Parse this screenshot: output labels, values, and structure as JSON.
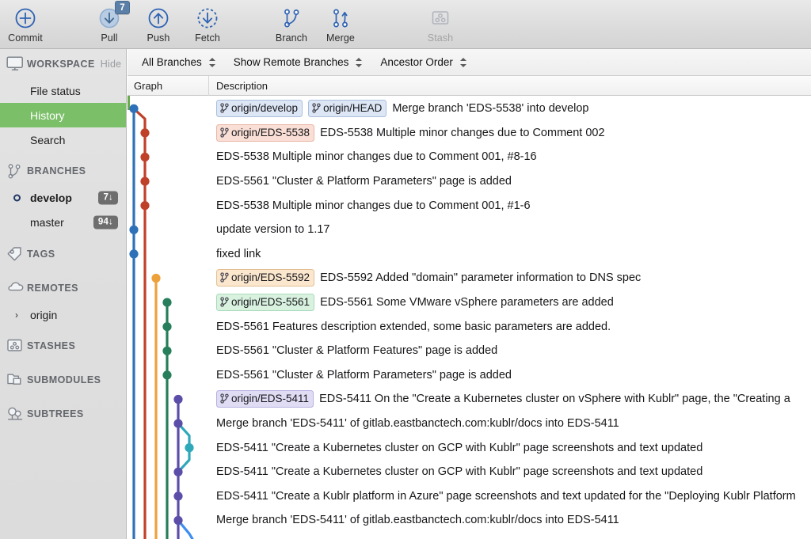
{
  "toolbar": {
    "items": [
      {
        "label": "Commit",
        "icon": "commit-plus-icon",
        "badge": null,
        "disabled": false
      },
      {
        "label": "Pull",
        "icon": "pull-down-arrow-icon",
        "badge": "7",
        "disabled": false
      },
      {
        "label": "Push",
        "icon": "push-up-arrow-icon",
        "badge": null,
        "disabled": false
      },
      {
        "label": "Fetch",
        "icon": "fetch-dashed-down-arrow-icon",
        "badge": null,
        "disabled": false
      },
      {
        "label": "Branch",
        "icon": "branch-icon",
        "badge": null,
        "disabled": false
      },
      {
        "label": "Merge",
        "icon": "merge-icon",
        "badge": null,
        "disabled": false
      },
      {
        "label": "Stash",
        "icon": "stash-icon",
        "badge": null,
        "disabled": true
      }
    ]
  },
  "sidebar": {
    "workspace": {
      "title": "WORKSPACE",
      "hide_label": "Hide",
      "icon": "monitor-icon"
    },
    "workspace_items": [
      {
        "label": "File status",
        "selected": false
      },
      {
        "label": "History",
        "selected": true
      },
      {
        "label": "Search",
        "selected": false
      }
    ],
    "branches": {
      "title": "BRANCHES",
      "icon": "branch-icon"
    },
    "branch_items": [
      {
        "label": "develop",
        "count": "7↓",
        "current": true
      },
      {
        "label": "master",
        "count": "94↓",
        "current": false
      }
    ],
    "tags": {
      "title": "TAGS",
      "icon": "tag-icon"
    },
    "remotes": {
      "title": "REMOTES",
      "icon": "cloud-icon"
    },
    "remote_items": [
      {
        "label": "origin",
        "expanded": false
      }
    ],
    "stashes": {
      "title": "STASHES",
      "icon": "stash-icon"
    },
    "submodules": {
      "title": "SUBMODULES",
      "icon": "submodules-icon"
    },
    "subtrees": {
      "title": "SUBTREES",
      "icon": "subtrees-icon"
    }
  },
  "filter_bar": {
    "branch_filter": "All Branches",
    "remote_filter": "Show Remote Branches",
    "order_filter": "Ancestor Order"
  },
  "columns": {
    "graph": "Graph",
    "description": "Description"
  },
  "commits": [
    {
      "refs": [
        {
          "name": "origin/develop",
          "style": "tag-blue"
        },
        {
          "name": "origin/HEAD",
          "style": "tag-blue"
        }
      ],
      "message": "Merge branch 'EDS-5538' into develop"
    },
    {
      "refs": [
        {
          "name": "origin/EDS-5538",
          "style": "tag-red"
        }
      ],
      "message": "EDS-5538 Multiple minor changes due to Comment 002"
    },
    {
      "refs": [],
      "message": "EDS-5538 Multiple minor changes due to Comment 001, #8-16"
    },
    {
      "refs": [],
      "message": "EDS-5561 \"Cluster & Platform Parameters\" page is added"
    },
    {
      "refs": [],
      "message": "EDS-5538 Multiple minor changes due to Comment 001, #1-6"
    },
    {
      "refs": [],
      "message": "update version to 1.17"
    },
    {
      "refs": [],
      "message": "fixed link"
    },
    {
      "refs": [
        {
          "name": "origin/EDS-5592",
          "style": "tag-orange"
        }
      ],
      "message": "EDS-5592 Added \"domain\" parameter information to DNS spec"
    },
    {
      "refs": [
        {
          "name": "origin/EDS-5561",
          "style": "tag-green"
        }
      ],
      "message": "EDS-5561 Some VMware vSphere parameters are added"
    },
    {
      "refs": [],
      "message": "EDS-5561 Features description extended, some basic parameters are added."
    },
    {
      "refs": [],
      "message": "EDS-5561 \"Cluster & Platform Features\" page is added"
    },
    {
      "refs": [],
      "message": "EDS-5561 \"Cluster & Platform Parameters\" page is added"
    },
    {
      "refs": [
        {
          "name": "origin/EDS-5411",
          "style": "tag-purple"
        }
      ],
      "message": "EDS-5411 On the \"Create a Kubernetes cluster on vSphere with Kublr\" page, the \"Creating a"
    },
    {
      "refs": [],
      "message": "Merge branch 'EDS-5411' of gitlab.eastbanctech.com:kublr/docs into EDS-5411"
    },
    {
      "refs": [],
      "message": "EDS-5411 \"Create a Kubernetes cluster on GCP with Kublr\" page screenshots and text updated"
    },
    {
      "refs": [],
      "message": "EDS-5411 \"Create a Kubernetes cluster on GCP with Kublr\" page screenshots and text updated"
    },
    {
      "refs": [],
      "message": "EDS-5411 \"Create a Kublr platform in Azure\" page screenshots and text updated for the \"Deploying Kublr Platform"
    },
    {
      "refs": [],
      "message": "Merge branch 'EDS-5411' of gitlab.eastbanctech.com:kublr/docs into EDS-5411"
    }
  ],
  "graph": {
    "colors": {
      "blue": "#2f71b8",
      "red": "#c0412a",
      "orange": "#eda13a",
      "green": "#267f5a",
      "purple": "#5b4ea8",
      "teal": "#2fa8ba",
      "lightblue": "#3d8ef0",
      "edge_green": "#6aaa4e"
    },
    "lanes": [
      {
        "color": "blue",
        "x": 8
      },
      {
        "color": "red",
        "x": 22
      },
      {
        "color": "orange",
        "x": 36
      },
      {
        "color": "green",
        "x": 50
      },
      {
        "color": "purple",
        "x": 64
      },
      {
        "color": "teal",
        "x": 78
      }
    ],
    "nodes": [
      {
        "row": 0,
        "lane": 0,
        "color": "blue"
      },
      {
        "row": 1,
        "lane": 1,
        "color": "red"
      },
      {
        "row": 2,
        "lane": 1,
        "color": "red"
      },
      {
        "row": 3,
        "lane": 1,
        "color": "red"
      },
      {
        "row": 4,
        "lane": 1,
        "color": "red"
      },
      {
        "row": 5,
        "lane": 0,
        "color": "blue"
      },
      {
        "row": 6,
        "lane": 0,
        "color": "blue"
      },
      {
        "row": 7,
        "lane": 2,
        "color": "orange"
      },
      {
        "row": 8,
        "lane": 3,
        "color": "green"
      },
      {
        "row": 9,
        "lane": 3,
        "color": "green"
      },
      {
        "row": 10,
        "lane": 3,
        "color": "green"
      },
      {
        "row": 11,
        "lane": 3,
        "color": "green"
      },
      {
        "row": 12,
        "lane": 4,
        "color": "purple"
      },
      {
        "row": 13,
        "lane": 4,
        "color": "purple"
      },
      {
        "row": 14,
        "lane": 5,
        "color": "teal"
      },
      {
        "row": 15,
        "lane": 4,
        "color": "purple"
      },
      {
        "row": 16,
        "lane": 4,
        "color": "purple"
      },
      {
        "row": 17,
        "lane": 4,
        "color": "purple"
      }
    ]
  }
}
